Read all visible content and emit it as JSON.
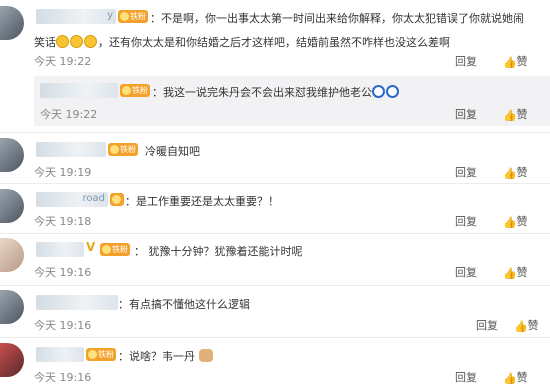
{
  "actions": {
    "reply": "回复",
    "like": "赞"
  },
  "badge": "铁粉",
  "comments": [
    {
      "name_vis": "y",
      "text1": "：不是啊，你一出事太太第一时间出来给你解释，你太太犯错误了你就说她闹",
      "text2_pre": "笑话",
      "text2_post": "，还有你太太是和你结婚之后才这样吧，结婚前虽然不咋样也没这么差啊",
      "time": "今天 19:22"
    },
    {
      "reply_text": "：我这一说完朱丹会不会出来怼我维护他老公",
      "time": "今天 19:22"
    },
    {
      "text": "冷暖自知吧",
      "time": "今天 19:19"
    },
    {
      "name_vis": "road",
      "text": "：是工作重要还是太太重要？！",
      "time": "今天 19:18"
    },
    {
      "text": "犹豫十分钟？犹豫着还能计时呢",
      "time": "今天 19:16"
    },
    {
      "text": "：有点搞不懂他这什么逻辑",
      "time": "今天 19:16"
    },
    {
      "text": "：说啥？韦一丹",
      "time": "今天 19:16"
    }
  ]
}
